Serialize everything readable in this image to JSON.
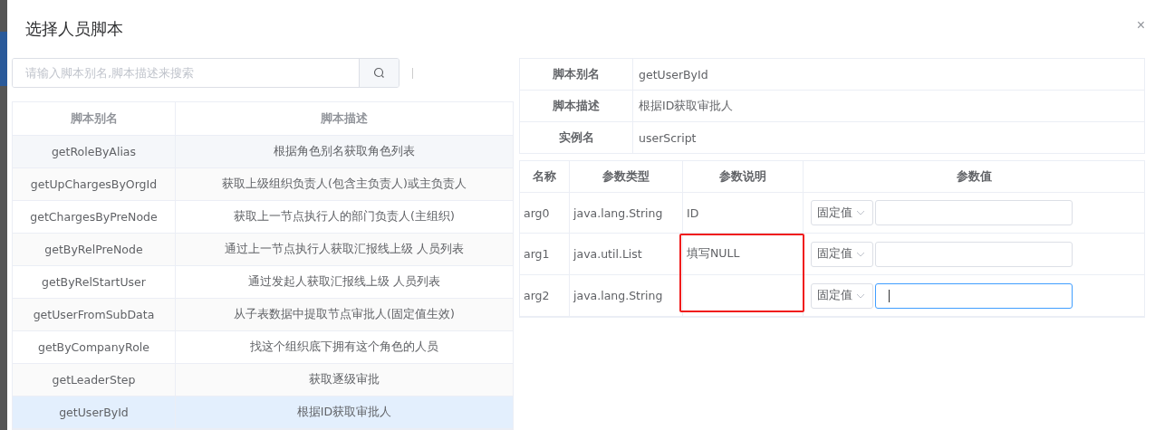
{
  "dialog": {
    "title": "选择人员脚本",
    "close": "×"
  },
  "search": {
    "placeholder": "请输入脚本别名,脚本描述来搜索"
  },
  "script_table": {
    "columns": [
      "脚本别名",
      "脚本描述"
    ],
    "rows": [
      {
        "alias": "getRoleByAlias",
        "description": "根据角色别名获取角色列表",
        "selected": false
      },
      {
        "alias": "getUpChargesByOrgId",
        "description": "获取上级组织负责人(包含主负责人)或主负责人",
        "selected": false
      },
      {
        "alias": "getChargesByPreNode",
        "description": "获取上一节点执行人的部门负责人(主组织)",
        "selected": false
      },
      {
        "alias": "getByRelPreNode",
        "description": "通过上一节点执行人获取汇报线上级 人员列表",
        "selected": false
      },
      {
        "alias": "getByRelStartUser",
        "description": "通过发起人获取汇报线上级 人员列表",
        "selected": false
      },
      {
        "alias": "getUserFromSubData",
        "description": "从子表数据中提取节点审批人(固定值生效)",
        "selected": false
      },
      {
        "alias": "getByCompanyRole",
        "description": "找这个组织底下拥有这个角色的人员",
        "selected": false
      },
      {
        "alias": "getLeaderStep",
        "description": "获取逐级审批",
        "selected": false
      },
      {
        "alias": "getUserById",
        "description": "根据ID获取审批人",
        "selected": true
      }
    ]
  },
  "details": [
    {
      "label": "脚本别名",
      "value": "getUserById"
    },
    {
      "label": "脚本描述",
      "value": "根据ID获取审批人"
    },
    {
      "label": "实例名",
      "value": "userScript"
    }
  ],
  "param_table": {
    "columns": [
      "名称",
      "参数类型",
      "参数说明",
      "参数值"
    ],
    "rows": [
      {
        "name": "arg0",
        "type": "java.lang.String",
        "note": "ID",
        "mode": "固定值",
        "focused": false
      },
      {
        "name": "arg1",
        "type": "java.util.List",
        "note": "填写NULL",
        "mode": "固定值",
        "focused": false
      },
      {
        "name": "arg2",
        "type": "java.lang.String",
        "note": "",
        "mode": "固定值",
        "focused": true
      }
    ]
  }
}
